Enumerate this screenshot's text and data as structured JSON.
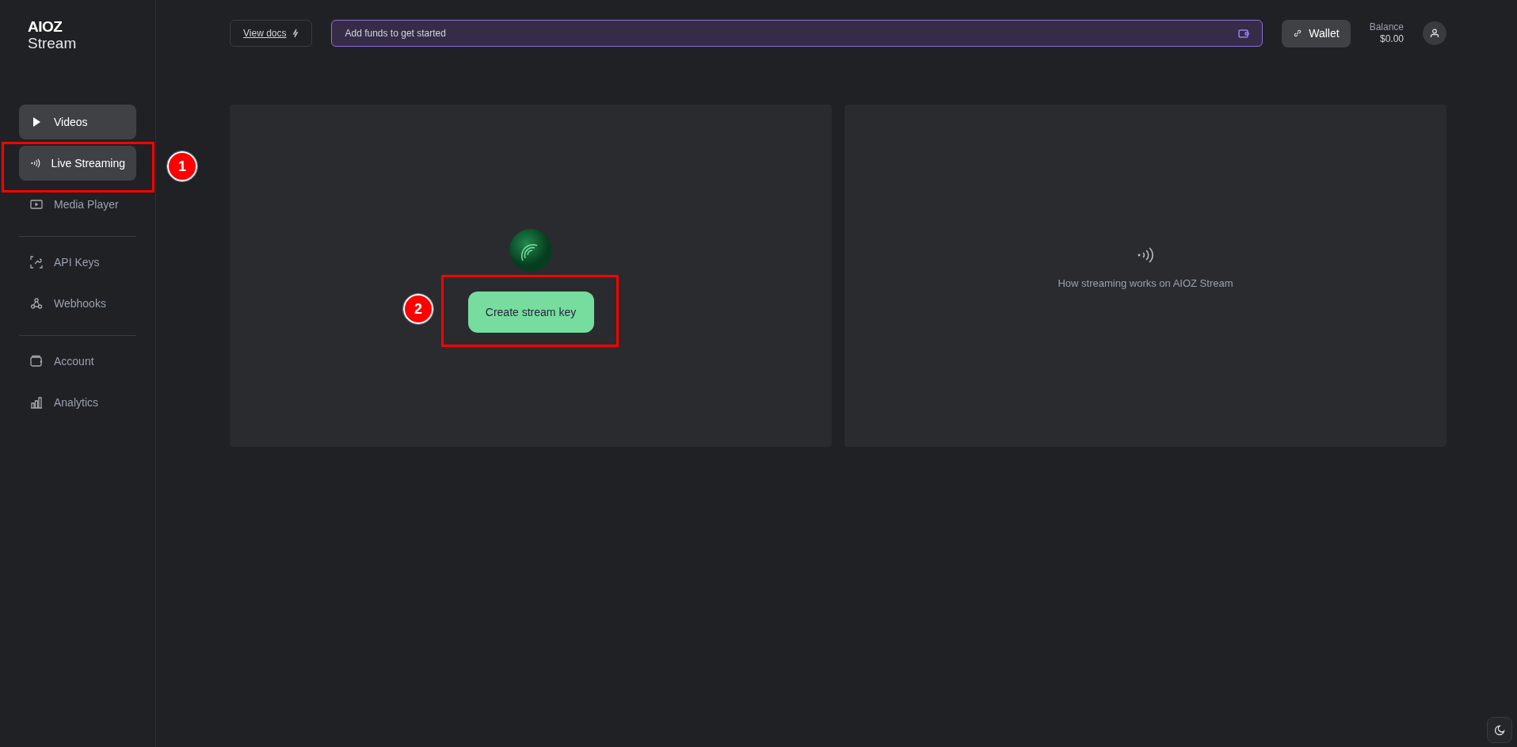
{
  "logo": {
    "brand": "AIOZ",
    "product": "Stream"
  },
  "sidebar": {
    "groups": [
      [
        {
          "label": "Videos",
          "highlighted": true
        },
        {
          "label": "Live Streaming",
          "highlighted": true
        },
        {
          "label": "Media Player",
          "highlighted": false
        }
      ],
      [
        {
          "label": "API Keys",
          "highlighted": false
        },
        {
          "label": "Webhooks",
          "highlighted": false
        }
      ],
      [
        {
          "label": "Account",
          "highlighted": false
        },
        {
          "label": "Analytics",
          "highlighted": false
        }
      ]
    ]
  },
  "topbar": {
    "docs_link": "View docs",
    "funds_banner": "Add funds to get started",
    "wallet_button": "Wallet",
    "balance_label": "Balance",
    "balance_value": "$0.00"
  },
  "main": {
    "create_button": "Create stream key",
    "info_text": "How streaming works on AIOZ Stream"
  },
  "annotations": [
    {
      "label": "1"
    },
    {
      "label": "2"
    }
  ]
}
